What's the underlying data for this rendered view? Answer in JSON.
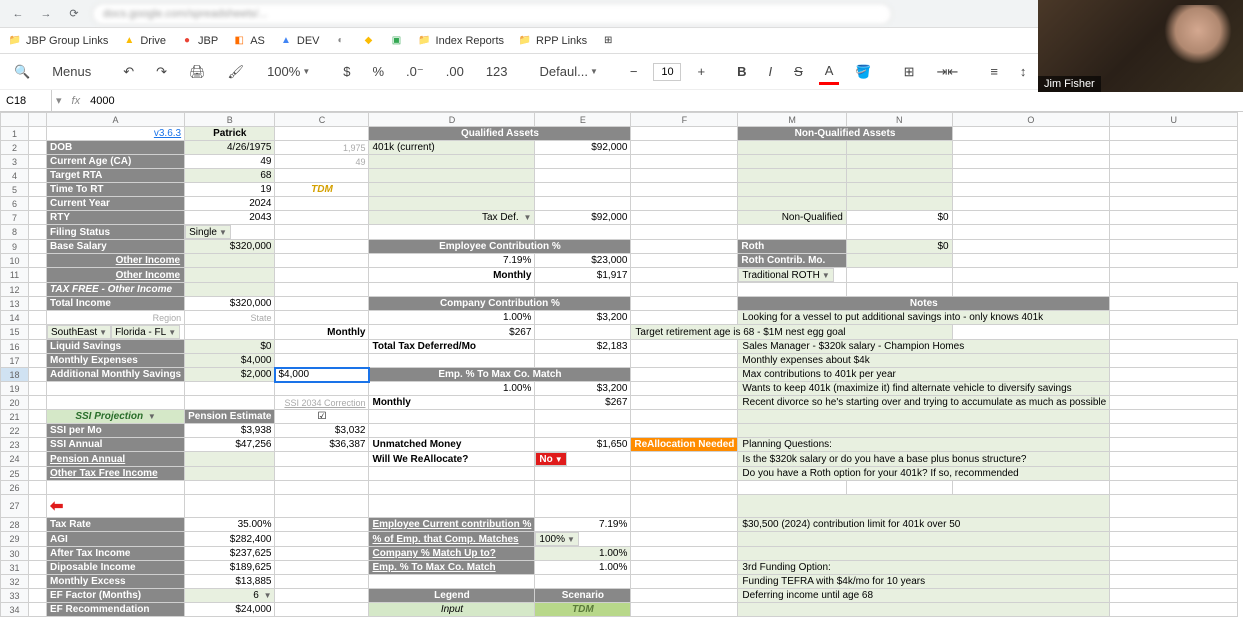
{
  "browser": {
    "url": "docs.google.com/spreadsheets/..."
  },
  "bookmarks": [
    {
      "icon": "📁",
      "label": "JBP Group Links"
    },
    {
      "icon": "▲",
      "label": "Drive",
      "color": "#4285f4"
    },
    {
      "icon": "🔴",
      "label": "JBP"
    },
    {
      "icon": "📊",
      "label": "AS"
    },
    {
      "icon": "🟠",
      "label": "DEV"
    },
    {
      "icon": "◐",
      "label": ""
    },
    {
      "icon": "◆",
      "label": ""
    },
    {
      "icon": "▣",
      "label": ""
    },
    {
      "icon": "📁",
      "label": "Index Reports"
    },
    {
      "icon": "📁",
      "label": "RPP Links"
    },
    {
      "icon": "⊞",
      "label": ""
    }
  ],
  "toolbar": {
    "menus": "Menus",
    "zoom": "100%",
    "font": "Defaul...",
    "size": "10"
  },
  "formula": {
    "cell": "C18",
    "value": "4000"
  },
  "cols": [
    "",
    "A",
    "B",
    "C",
    "D",
    "E",
    "F",
    "M",
    "N",
    "O",
    "U"
  ],
  "data": {
    "version": "v3.6.3",
    "name": "Patrick",
    "dob": "4/26/1975",
    "age": "49",
    "rta": "68",
    "ttr": "19",
    "year": "2024",
    "rty": "2043",
    "filing": "Single",
    "salary": "$320,000",
    "oi1": "Other Income",
    "oi2": "Other Income",
    "tfoi": "TAX FREE - Other Income",
    "ti": "$320,000",
    "region": "SouthEast",
    "state": "Florida - FL",
    "liquid": "$0",
    "mexp": "$4,000",
    "ams": "$2,000",
    "ams_c": "$4,000",
    "ssipm": "$3,938",
    "ssia": "$47,256",
    "c22": "$3,032",
    "c23": "$36,387",
    "taxrate": "35.00%",
    "agi": "$282,400",
    "ati": "$237,625",
    "dispi": "$189,625",
    "mex": "$13,885",
    "eff": "6",
    "efrec": "$24,000",
    "q_assets": "Qualified Assets",
    "nq_assets": "Non-Qualified Assets",
    "k401": "401k (current)",
    "k401v": "$92,000",
    "taxdef": "Tax Def.",
    "taxdefv": "$92,000",
    "nq": "Non-Qualified",
    "nqv": "$0",
    "ecp": "Employee Contribution %",
    "ecpp": "7.19%",
    "ecpv": "$23,000",
    "ecpm": "Monthly",
    "ecpmv": "$1,917",
    "roth": "Roth",
    "rothv": "$0",
    "rothcm": "Roth Contrib. Mo.",
    "tradroth": "Traditional ROTH",
    "ccp": "Company Contribution %",
    "ccpp": "1.00%",
    "ccpv": "$3,200",
    "ccpm": "Monthly",
    "ccpmv": "$267",
    "ttdm": "Total Tax Deferred/Mo",
    "ttdmv": "$2,183",
    "emc": "Emp. % To Max Co. Match",
    "emcp": "1.00%",
    "emcv": "$3,200",
    "emcm": "Monthly",
    "emcmv": "$267",
    "ssi2034": "SSI 2034 Correction",
    "um": "Unmatched Money",
    "umv": "$1,650",
    "rean": "ReAllocation Needed",
    "wwr": "Will We ReAllocate?",
    "wwrv": "No",
    "eccp": "Employee Current contribution %",
    "eccpv": "7.19%",
    "pecm": "% of Emp. that Comp. Matches",
    "pecmv": "100%",
    "cmut": "Company % Match Up to?",
    "cmutv": "1.00%",
    "emcm2": "Emp. % To Max Co. Match",
    "emcm2v": "1.00%",
    "legend": "Legend",
    "scenario": "Scenario",
    "input": "Input",
    "tdm2": "TDM",
    "notes_h": "Notes",
    "n1": "Looking for a vessel to put additional savings into - only knows 401k",
    "n2": "Target retirement age is 68 - $1M nest egg goal",
    "n3": "Sales Manager - $320k salary - Champion Homes",
    "n4": "Monthly expenses about $4k",
    "n5": "Max contributions to 401k per year",
    "n6": "Wants to keep 401k (maximize it) find alternate vehicle to diversify savings",
    "n7": "Recent divorce so he's starting over and trying to accumulate as much as possible",
    "pq": "Planning Questions:",
    "pq1": "Is the $320k salary or do you have a base plus bonus structure?",
    "pq2": "Do you have a Roth option for your 401k? If so, recommended",
    "lim": "$30,500 (2024) contribution limit for 401k over 50",
    "fo": "3rd Funding Option:",
    "fo1": "Funding TEFRA with $4k/mo for 10 years",
    "fo2": "Deferring income until age 68",
    "c2": "1,975",
    "c3": "49",
    "tdm": "TDM",
    "ssi_proj": "SSI Projection",
    "pen_est": "Pension Estimate",
    "region_lbl": "Region",
    "state_lbl": "State",
    "pa": "Pension Annual",
    "otfi": "Other Tax Free Income"
  },
  "webcam": {
    "name": "Jim Fisher"
  }
}
